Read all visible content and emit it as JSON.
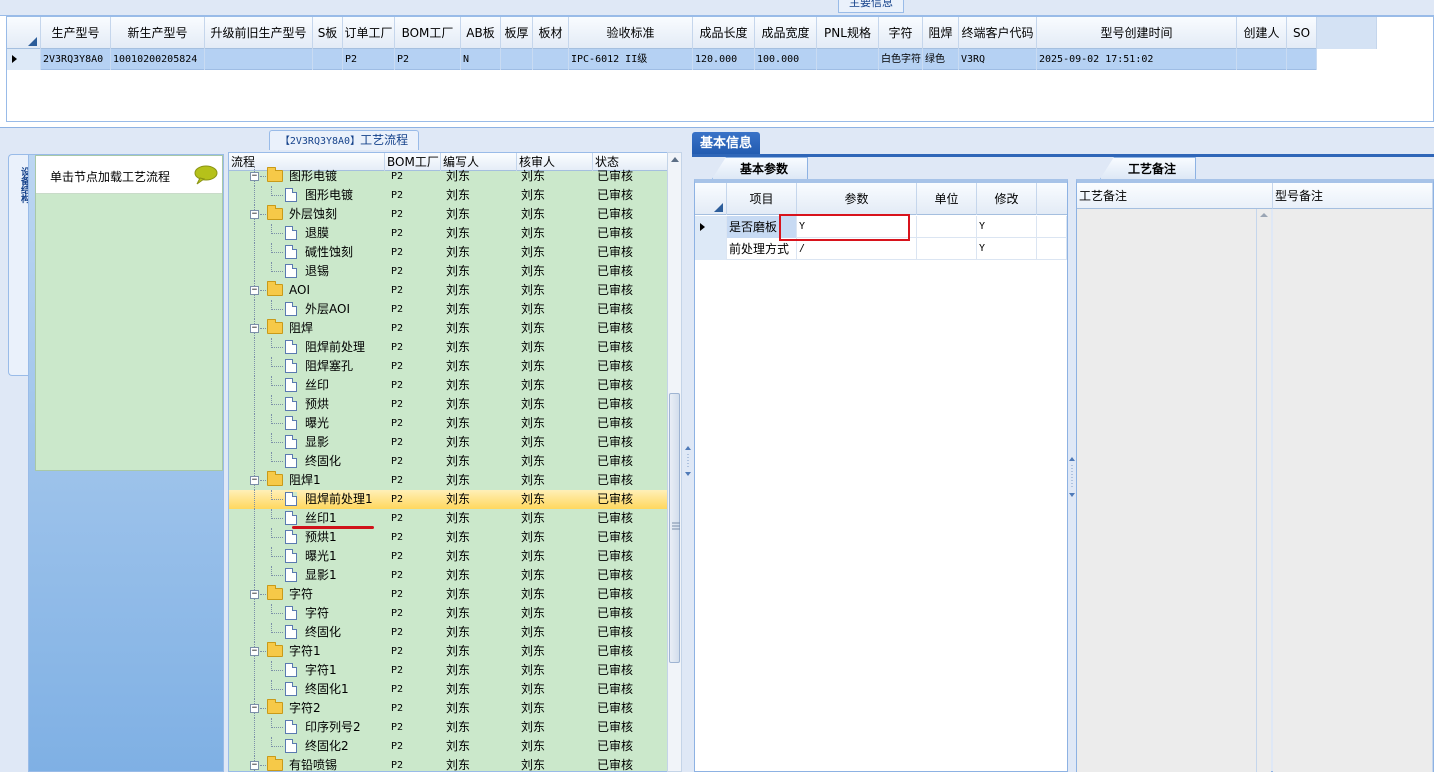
{
  "top": {
    "title": "主要信息",
    "columns": [
      "生产型号",
      "新生产型号",
      "升级前旧生产型号",
      "S板",
      "订单工厂",
      "BOM工厂",
      "AB板",
      "板厚",
      "板材",
      "验收标准",
      "成品长度",
      "成品宽度",
      "PNL规格",
      "字符",
      "阻焊",
      "终端客户代码",
      "型号创建时间",
      "创建人",
      "SO"
    ],
    "row": [
      "2V3RQ3Y8A0",
      "10010200205824",
      "",
      "",
      "P2",
      "P2",
      "N",
      "",
      "",
      "IPC-6012 II级",
      "120.000",
      "100.000",
      "",
      "白色字符",
      "绿色",
      "V3RQ",
      "2025-09-02 17:51:02",
      "",
      ""
    ]
  },
  "left": {
    "vertical_tab": "设备结构",
    "hint": "单击节点加载工艺流程",
    "hint_icon": "speech-bubble-icon"
  },
  "flow": {
    "title_model": "【2V3RQ3Y8A0】",
    "title_suffix": "工艺流程",
    "columns": [
      "流程",
      "BOM工厂",
      "编写人",
      "核审人",
      "状态"
    ],
    "rows": [
      {
        "level": 1,
        "type": "folder",
        "name": "图形电镀",
        "bom": "P2",
        "writer": "刘东",
        "reviewer": "刘东",
        "status": "已审核"
      },
      {
        "level": 2,
        "type": "doc",
        "name": "图形电镀",
        "bom": "P2",
        "writer": "刘东",
        "reviewer": "刘东",
        "status": "已审核"
      },
      {
        "level": 1,
        "type": "folder",
        "name": "外层蚀刻",
        "bom": "P2",
        "writer": "刘东",
        "reviewer": "刘东",
        "status": "已审核"
      },
      {
        "level": 2,
        "type": "doc",
        "name": "退膜",
        "bom": "P2",
        "writer": "刘东",
        "reviewer": "刘东",
        "status": "已审核"
      },
      {
        "level": 2,
        "type": "doc",
        "name": "碱性蚀刻",
        "bom": "P2",
        "writer": "刘东",
        "reviewer": "刘东",
        "status": "已审核"
      },
      {
        "level": 2,
        "type": "doc",
        "name": "退锡",
        "bom": "P2",
        "writer": "刘东",
        "reviewer": "刘东",
        "status": "已审核"
      },
      {
        "level": 1,
        "type": "folder",
        "name": "AOI",
        "bom": "P2",
        "writer": "刘东",
        "reviewer": "刘东",
        "status": "已审核"
      },
      {
        "level": 2,
        "type": "doc",
        "name": "外层AOI",
        "bom": "P2",
        "writer": "刘东",
        "reviewer": "刘东",
        "status": "已审核"
      },
      {
        "level": 1,
        "type": "folder",
        "name": "阻焊",
        "bom": "P2",
        "writer": "刘东",
        "reviewer": "刘东",
        "status": "已审核"
      },
      {
        "level": 2,
        "type": "doc",
        "name": "阻焊前处理",
        "bom": "P2",
        "writer": "刘东",
        "reviewer": "刘东",
        "status": "已审核"
      },
      {
        "level": 2,
        "type": "doc",
        "name": "阻焊塞孔",
        "bom": "P2",
        "writer": "刘东",
        "reviewer": "刘东",
        "status": "已审核"
      },
      {
        "level": 2,
        "type": "doc",
        "name": "丝印",
        "bom": "P2",
        "writer": "刘东",
        "reviewer": "刘东",
        "status": "已审核"
      },
      {
        "level": 2,
        "type": "doc",
        "name": "预烘",
        "bom": "P2",
        "writer": "刘东",
        "reviewer": "刘东",
        "status": "已审核"
      },
      {
        "level": 2,
        "type": "doc",
        "name": "曝光",
        "bom": "P2",
        "writer": "刘东",
        "reviewer": "刘东",
        "status": "已审核"
      },
      {
        "level": 2,
        "type": "doc",
        "name": "显影",
        "bom": "P2",
        "writer": "刘东",
        "reviewer": "刘东",
        "status": "已审核"
      },
      {
        "level": 2,
        "type": "doc",
        "name": "终固化",
        "bom": "P2",
        "writer": "刘东",
        "reviewer": "刘东",
        "status": "已审核"
      },
      {
        "level": 1,
        "type": "folder",
        "name": "阻焊1",
        "bom": "P2",
        "writer": "刘东",
        "reviewer": "刘东",
        "status": "已审核"
      },
      {
        "level": 2,
        "type": "doc",
        "name": "阻焊前处理1",
        "bom": "P2",
        "writer": "刘东",
        "reviewer": "刘东",
        "status": "已审核",
        "selected": true
      },
      {
        "level": 2,
        "type": "doc",
        "name": "丝印1",
        "bom": "P2",
        "writer": "刘东",
        "reviewer": "刘东",
        "status": "已审核"
      },
      {
        "level": 2,
        "type": "doc",
        "name": "预烘1",
        "bom": "P2",
        "writer": "刘东",
        "reviewer": "刘东",
        "status": "已审核"
      },
      {
        "level": 2,
        "type": "doc",
        "name": "曝光1",
        "bom": "P2",
        "writer": "刘东",
        "reviewer": "刘东",
        "status": "已审核"
      },
      {
        "level": 2,
        "type": "doc",
        "name": "显影1",
        "bom": "P2",
        "writer": "刘东",
        "reviewer": "刘东",
        "status": "已审核"
      },
      {
        "level": 1,
        "type": "folder",
        "name": "字符",
        "bom": "P2",
        "writer": "刘东",
        "reviewer": "刘东",
        "status": "已审核"
      },
      {
        "level": 2,
        "type": "doc",
        "name": "字符",
        "bom": "P2",
        "writer": "刘东",
        "reviewer": "刘东",
        "status": "已审核"
      },
      {
        "level": 2,
        "type": "doc",
        "name": "终固化",
        "bom": "P2",
        "writer": "刘东",
        "reviewer": "刘东",
        "status": "已审核"
      },
      {
        "level": 1,
        "type": "folder",
        "name": "字符1",
        "bom": "P2",
        "writer": "刘东",
        "reviewer": "刘东",
        "status": "已审核"
      },
      {
        "level": 2,
        "type": "doc",
        "name": "字符1",
        "bom": "P2",
        "writer": "刘东",
        "reviewer": "刘东",
        "status": "已审核"
      },
      {
        "level": 2,
        "type": "doc",
        "name": "终固化1",
        "bom": "P2",
        "writer": "刘东",
        "reviewer": "刘东",
        "status": "已审核"
      },
      {
        "level": 1,
        "type": "folder",
        "name": "字符2",
        "bom": "P2",
        "writer": "刘东",
        "reviewer": "刘东",
        "status": "已审核"
      },
      {
        "level": 2,
        "type": "doc",
        "name": "印序列号2",
        "bom": "P2",
        "writer": "刘东",
        "reviewer": "刘东",
        "status": "已审核"
      },
      {
        "level": 2,
        "type": "doc",
        "name": "终固化2",
        "bom": "P2",
        "writer": "刘东",
        "reviewer": "刘东",
        "status": "已审核"
      },
      {
        "level": 1,
        "type": "folder",
        "name": "有铅喷锡",
        "bom": "P2",
        "writer": "刘东",
        "reviewer": "刘东",
        "status": "已审核"
      },
      {
        "level": 2,
        "type": "doc",
        "name": "",
        "bom": "",
        "writer": "",
        "reviewer": "",
        "status": ""
      }
    ]
  },
  "info": {
    "tab": "基本信息",
    "params_tab": "基本参数",
    "params_columns": [
      "项目",
      "参数",
      "单位",
      "修改"
    ],
    "params_rows": [
      {
        "item": "是否磨板",
        "param": "Y",
        "unit": "",
        "modify": "Y"
      },
      {
        "item": "前处理方式",
        "param": "/",
        "unit": "",
        "modify": "Y"
      }
    ],
    "notes_tab": "工艺备注",
    "notes_columns": [
      "工艺备注",
      "型号备注"
    ]
  },
  "colors": {
    "accent": "#2059ae",
    "tree_bg": "#cbe8cb",
    "selection": "#ffd75e",
    "highlight_red": "#d8131c"
  }
}
